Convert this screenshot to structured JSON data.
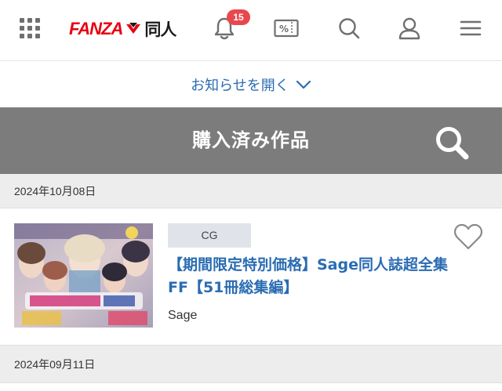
{
  "header": {
    "logo_brand": "FANZA",
    "logo_sub": "同人",
    "notification_count": "15",
    "coupon_symbol": "%",
    "brand_color": "#e60012",
    "icons": [
      "grid-menu-icon",
      "bell-icon",
      "coupon-icon",
      "search-icon",
      "user-icon",
      "hamburger-menu-icon"
    ]
  },
  "notice": {
    "label": "お知らせを開く"
  },
  "titlebar": {
    "title": "購入済み作品"
  },
  "purchases": [
    {
      "date": "2024年10月08日",
      "items": [
        {
          "category": "CG",
          "title": "【期間限定特別価格】Sage同人誌超全集FF【51冊総集編】",
          "circle": "Sage"
        }
      ]
    },
    {
      "date": "2024年09月11日",
      "items": []
    }
  ],
  "colors": {
    "link": "#2a6cb2",
    "titlebar_bg": "#7c7c7c",
    "badge": "#e8484d",
    "date_row_bg": "#ededed"
  }
}
